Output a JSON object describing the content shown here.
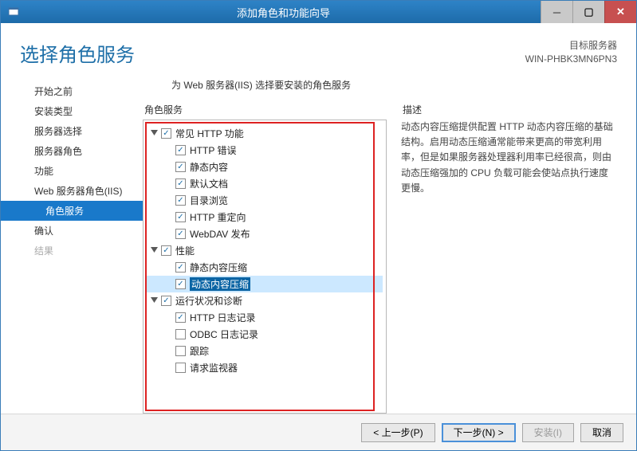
{
  "window": {
    "title": "添加角色和功能向导"
  },
  "header": {
    "title": "选择角色服务",
    "target_label": "目标服务器",
    "target_value": "WIN-PHBK3MN6PN3"
  },
  "nav": [
    {
      "label": "开始之前",
      "lvl": 1
    },
    {
      "label": "安装类型",
      "lvl": 1
    },
    {
      "label": "服务器选择",
      "lvl": 1
    },
    {
      "label": "服务器角色",
      "lvl": 1
    },
    {
      "label": "功能",
      "lvl": 1
    },
    {
      "label": "Web 服务器角色(IIS)",
      "lvl": 1
    },
    {
      "label": "角色服务",
      "lvl": 2,
      "selected": true
    },
    {
      "label": "确认",
      "lvl": 1
    },
    {
      "label": "结果",
      "lvl": 1,
      "disabled": true
    }
  ],
  "instruction": "为 Web 服务器(IIS) 选择要安装的角色服务",
  "roles_label": "角色服务",
  "desc_label": "描述",
  "desc_text": "动态内容压缩提供配置 HTTP 动态内容压缩的基础结构。启用动态压缩通常能带来更高的带宽利用率，但是如果服务器处理器利用率已经很高，则由动态压缩强加的 CPU 负载可能会使站点执行速度更慢。",
  "tree": [
    {
      "indent": 1,
      "exp": true,
      "cb": "checked",
      "label": "常见 HTTP 功能"
    },
    {
      "indent": 2,
      "cb": "checked",
      "label": "HTTP 错误"
    },
    {
      "indent": 2,
      "cb": "checked",
      "label": "静态内容"
    },
    {
      "indent": 2,
      "cb": "checked",
      "label": "默认文档"
    },
    {
      "indent": 2,
      "cb": "checked",
      "label": "目录浏览"
    },
    {
      "indent": 2,
      "cb": "checked",
      "label": "HTTP 重定向"
    },
    {
      "indent": 2,
      "cb": "checked",
      "label": "WebDAV 发布"
    },
    {
      "indent": 1,
      "exp": true,
      "cb": "checked",
      "label": "性能"
    },
    {
      "indent": 2,
      "cb": "checked",
      "label": "静态内容压缩"
    },
    {
      "indent": 2,
      "cb": "checked",
      "label": "动态内容压缩",
      "selected": true
    },
    {
      "indent": 1,
      "exp": true,
      "cb": "checked",
      "label": "运行状况和诊断"
    },
    {
      "indent": 2,
      "cb": "checked",
      "label": "HTTP 日志记录"
    },
    {
      "indent": 2,
      "cb": "",
      "label": "ODBC 日志记录"
    },
    {
      "indent": 2,
      "cb": "",
      "label": "跟踪"
    },
    {
      "indent": 2,
      "cb": "",
      "label": "请求监视器"
    }
  ],
  "buttons": {
    "prev": "< 上一步(P)",
    "next": "下一步(N) >",
    "install": "安装(I)",
    "cancel": "取消"
  }
}
